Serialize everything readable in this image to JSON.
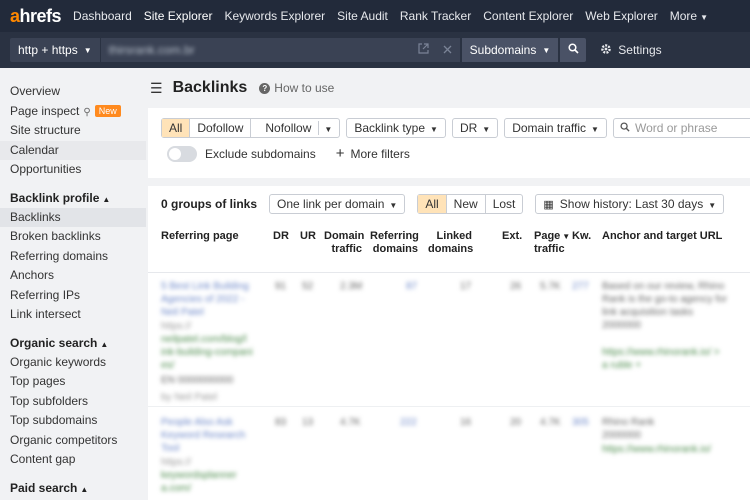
{
  "logo": {
    "first": "a",
    "rest": "hrefs"
  },
  "topnav": {
    "items": [
      "Dashboard",
      "Site Explorer",
      "Keywords Explorer",
      "Site Audit",
      "Rank Tracker",
      "Content Explorer",
      "Web Explorer"
    ],
    "active": "Site Explorer",
    "more": "More"
  },
  "search": {
    "protocol": "http + https",
    "url_value": "thirsrank.com.br",
    "mode": "Subdomains",
    "settings_label": "Settings"
  },
  "sidebar": {
    "top_items": [
      "Overview",
      "Page inspect",
      "Site structure",
      "Calendar",
      "Opportunities"
    ],
    "new_badge": "New",
    "backlink_head": "Backlink profile",
    "backlink_items": [
      "Backlinks",
      "Broken backlinks",
      "Referring domains",
      "Anchors",
      "Referring IPs",
      "Link intersect"
    ],
    "organic_head": "Organic search",
    "organic_items": [
      "Organic keywords",
      "Top pages",
      "Top subfolders",
      "Top subdomains",
      "Organic competitors",
      "Content gap"
    ],
    "paid_head": "Paid search"
  },
  "page": {
    "title": "Backlinks",
    "how_to": "How to use"
  },
  "filters": {
    "link_types": [
      "All",
      "Dofollow",
      "Nofollow"
    ],
    "link_type_selected": "All",
    "backlink_type": "Backlink type",
    "dr": "DR",
    "domain_traffic": "Domain traffic",
    "word_placeholder": "Word or phrase",
    "exclude_subdomains": "Exclude subdomains",
    "more_filters": "More filters"
  },
  "table": {
    "groups_label": "0 groups of links",
    "per_domain": "One link per domain",
    "status_tabs": [
      "All",
      "New",
      "Lost"
    ],
    "status_selected": "All",
    "history": "Show history: Last 30 days",
    "headers": {
      "ref_page": "Referring page",
      "dr": "DR",
      "ur": "UR",
      "domain_traffic_1": "Domain",
      "domain_traffic_2": "traffic",
      "ref_domains_1": "Referring",
      "ref_domains_2": "domains",
      "linked_1": "Linked",
      "linked_2": "domains",
      "ext": "Ext.",
      "page_traffic_1": "Page",
      "page_traffic_2": "traffic",
      "kw": "Kw.",
      "anchor": "Anchor and target URL"
    },
    "rows": [
      {
        "title_l1": "5 Best Link Building",
        "title_l2": "Agencies of 2022 -",
        "title_l3": "Neil Patel",
        "lang": "https://",
        "url_l1": "neilpatel.com/blog/l",
        "url_l2": "ink-building-compani",
        "url_l3": "es/",
        "meta": "EN 0000000000",
        "meta2": "by Neil Patel",
        "dr": "91",
        "ur": "52",
        "dtraffic": "2.3M",
        "refdom": "87",
        "linked": "17",
        "ext": "26",
        "ptraffic": "5.7K",
        "kw": "277",
        "anchor_l1": "Based on our review, Rhino",
        "anchor_l2": "Rank is the go-to agency for",
        "anchor_l3": "link acquisition tasks",
        "anchor_l4": "2000000",
        "anchor_l5": "https://www.rhinorank.io/ >",
        "anchor_l6": "a ruble +"
      },
      {
        "title_l1": "People Also Ask",
        "title_l2": "Keyword Research",
        "title_l3": "Tool",
        "lang": "https://",
        "url_l1": "keywordsplanner",
        "url_l2": "a.com/",
        "dr": "83",
        "ur": "13",
        "dtraffic": "4.7K",
        "refdom": "222",
        "linked": "16",
        "ext": "20",
        "ptraffic": "4.7K",
        "kw": "305",
        "anchor_l1": "Rhino Rank",
        "anchor_l2": "2000000",
        "anchor_l3": "https://www.rhinorank.io/"
      }
    ]
  }
}
